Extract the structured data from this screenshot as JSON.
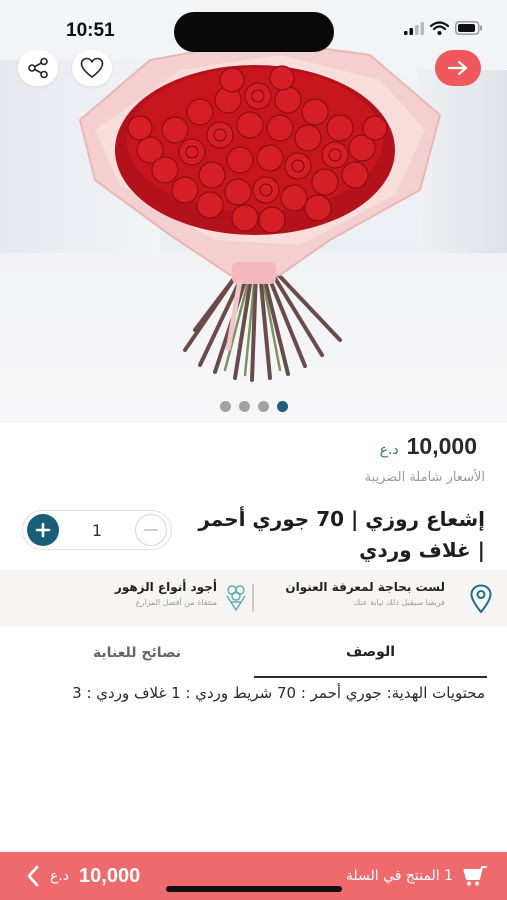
{
  "status_bar": {
    "time": "10:51"
  },
  "product": {
    "price": "10,000",
    "currency": "د.ع",
    "tax_note": "الأسعار شاملة الضريبة",
    "title": "إشعاع روزي | 70 جوري أحمر | غلاف وردي",
    "quantity": "1",
    "image_slides": 4,
    "active_slide": 4
  },
  "info": {
    "address_title": "لست بحاجة لمعرفة العنوان",
    "address_sub": "فريقنا سيقبل ذلك نيابة عنك",
    "flowers_title": "أجود أنواع الزهور",
    "flowers_sub": "منتقاة من أفضل المزارع"
  },
  "tabs": {
    "description": "الوصف",
    "care_tips": "نصائح للعناية"
  },
  "description_text": "محتويات الهدية: جوري أحمر : 70 شريط وردي : 1 غلاف وردي : 3",
  "cart": {
    "count_text": "1 المنتج في السلة",
    "total": "10,000",
    "currency": "د.ع"
  },
  "icons": {
    "share": "share-icon",
    "favorite": "heart-icon",
    "back": "arrow-right-icon",
    "location": "location-pin-icon",
    "flowers": "flower-icon",
    "cart": "cart-icon",
    "chevron": "chevron-left-icon"
  },
  "colors": {
    "accent": "#ef6a6d",
    "primary": "#1a5d78",
    "price_currency": "#1f8a3a"
  }
}
